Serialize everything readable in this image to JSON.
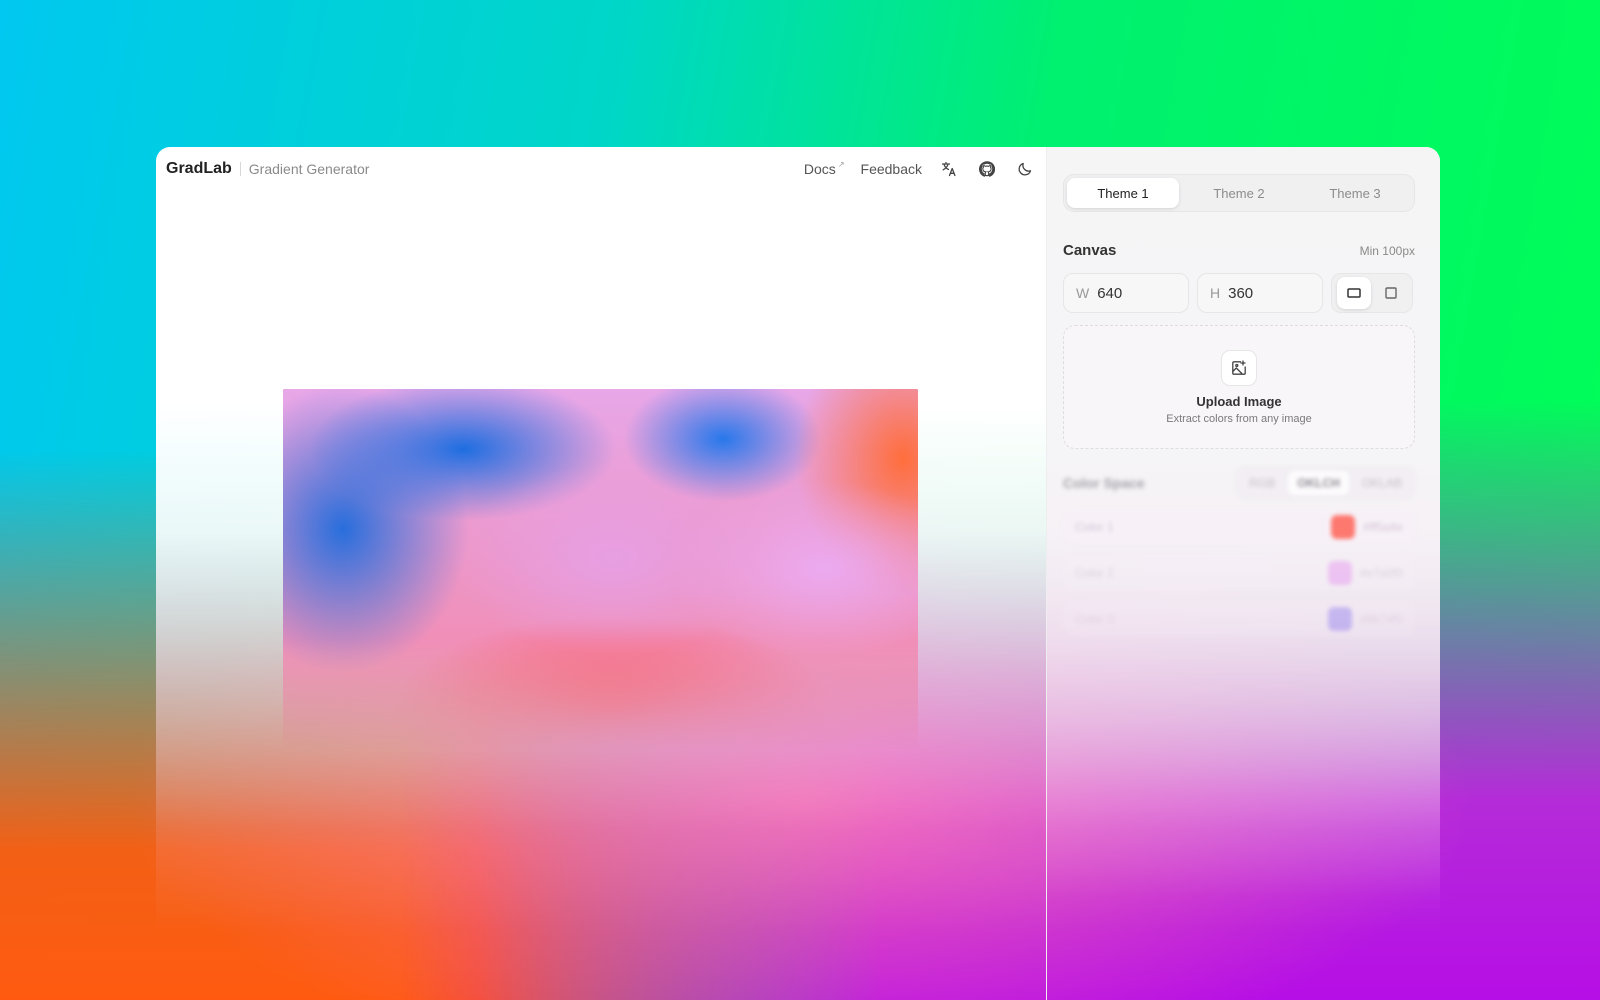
{
  "app": {
    "brand": "GradLab",
    "subtitle": "Gradient Generator"
  },
  "nav": {
    "docs_label": "Docs",
    "docs_ext_icon": "external-link-icon",
    "feedback_label": "Feedback",
    "icons": [
      "translate-icon",
      "github-icon",
      "moon-icon"
    ]
  },
  "tabs": [
    {
      "label": "Theme 1",
      "active": true
    },
    {
      "label": "Theme 2",
      "active": false
    },
    {
      "label": "Theme 3",
      "active": false
    }
  ],
  "canvas_section": {
    "title": "Canvas",
    "note": "Min 100px",
    "width_label": "W",
    "width_value": "640",
    "height_label": "H",
    "height_value": "360",
    "shapes": [
      {
        "icon": "landscape-rect-icon",
        "active": true
      },
      {
        "icon": "square-icon",
        "active": false
      }
    ]
  },
  "upload": {
    "icon": "image-plus-icon",
    "title": "Upload Image",
    "subtitle": "Extract colors from any image"
  },
  "color_space": {
    "title": "Color Space",
    "options": [
      {
        "label": "RGB",
        "active": false
      },
      {
        "label": "OKLCH",
        "active": true
      },
      {
        "label": "OKLAB",
        "active": false
      }
    ]
  },
  "color_stops": [
    {
      "label": "Color 1",
      "hex": "#ff5a4e",
      "value": "#ff5a4e"
    },
    {
      "label": "Color 2",
      "hex": "#e7a0f0",
      "value": "#e7a0f0"
    },
    {
      "label": "Color 3",
      "hex": "#8b74f0",
      "value": "#8b74f0"
    }
  ]
}
